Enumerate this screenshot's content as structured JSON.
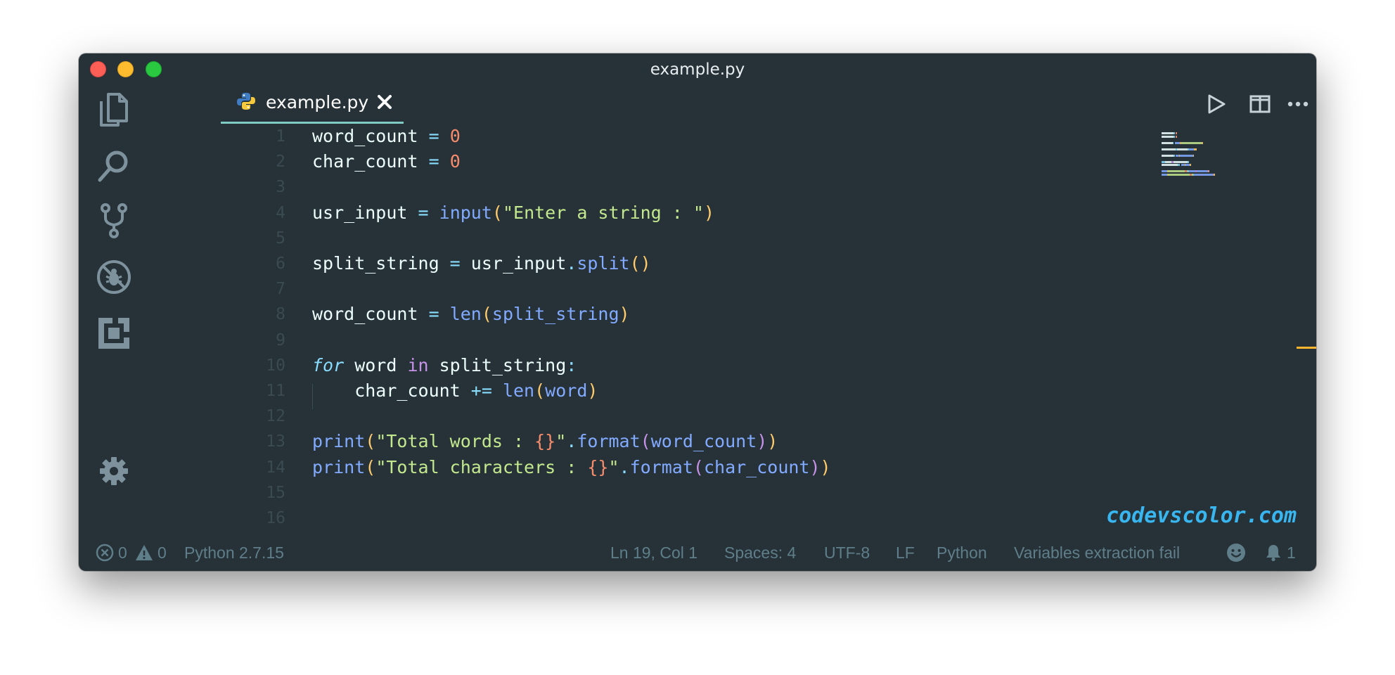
{
  "window": {
    "title": "example.py"
  },
  "activity_bar": {
    "items": [
      "explorer-icon",
      "search-icon",
      "source-control-icon",
      "debug-icon",
      "extensions-icon"
    ],
    "bottom": "gear-icon"
  },
  "tab": {
    "label": "example.py",
    "icon": "python-icon"
  },
  "editor_actions": [
    "run-icon",
    "split-editor-icon",
    "more-icon"
  ],
  "colors": {
    "background": "#263238",
    "variable": "#eeffff",
    "operator": "#89ddff",
    "number": "#f78c6c",
    "string": "#c3e88d",
    "function": "#82aaff",
    "keyword": "#c792ea",
    "paren": "#ffcb6b",
    "brace": "#f78c6c",
    "accent": "#80cbc4",
    "watermark": "#39b6f0"
  },
  "editor": {
    "line_numbers": [
      "1",
      "2",
      "3",
      "4",
      "5",
      "6",
      "7",
      "8",
      "9",
      "10",
      "11",
      "12",
      "13",
      "14",
      "15",
      "16"
    ],
    "lines": [
      [
        [
          "word_count ",
          "var"
        ],
        [
          "=",
          "op"
        ],
        [
          " ",
          "var"
        ],
        [
          "0",
          "num"
        ]
      ],
      [
        [
          "char_count ",
          "var"
        ],
        [
          "=",
          "op"
        ],
        [
          " ",
          "var"
        ],
        [
          "0",
          "num"
        ]
      ],
      [],
      [
        [
          "usr_input ",
          "var"
        ],
        [
          "=",
          "op"
        ],
        [
          " ",
          "var"
        ],
        [
          "input",
          "fn"
        ],
        [
          "(",
          "paren"
        ],
        [
          "\"Enter a string : \"",
          "str"
        ],
        [
          ")",
          "paren"
        ]
      ],
      [],
      [
        [
          "split_string ",
          "var"
        ],
        [
          "=",
          "op"
        ],
        [
          " usr_input",
          "var"
        ],
        [
          ".",
          "op"
        ],
        [
          "split",
          "fn"
        ],
        [
          "()",
          "paren"
        ]
      ],
      [],
      [
        [
          "word_count ",
          "var"
        ],
        [
          "=",
          "op"
        ],
        [
          " ",
          "var"
        ],
        [
          "len",
          "fn"
        ],
        [
          "(",
          "paren"
        ],
        [
          "split_string",
          "fn"
        ],
        [
          ")",
          "paren"
        ]
      ],
      [],
      [
        [
          "for",
          "kw-italic"
        ],
        [
          " word ",
          "var"
        ],
        [
          "in",
          "kw"
        ],
        [
          " split_string",
          "var"
        ],
        [
          ":",
          "op"
        ]
      ],
      [
        [
          "    char_count ",
          "var"
        ],
        [
          "+=",
          "op"
        ],
        [
          " ",
          "var"
        ],
        [
          "len",
          "fn"
        ],
        [
          "(",
          "paren"
        ],
        [
          "word",
          "fn"
        ],
        [
          ")",
          "paren"
        ]
      ],
      [],
      [
        [
          "print",
          "fn"
        ],
        [
          "(",
          "paren"
        ],
        [
          "\"Total words : ",
          "str"
        ],
        [
          "{}",
          "brace"
        ],
        [
          "\"",
          "str"
        ],
        [
          ".",
          "op"
        ],
        [
          "format",
          "fn"
        ],
        [
          "(",
          "paren2"
        ],
        [
          "word_count",
          "fn"
        ],
        [
          ")",
          "paren2"
        ],
        [
          ")",
          "paren"
        ]
      ],
      [
        [
          "print",
          "fn"
        ],
        [
          "(",
          "paren"
        ],
        [
          "\"Total characters : ",
          "str"
        ],
        [
          "{}",
          "brace"
        ],
        [
          "\"",
          "str"
        ],
        [
          ".",
          "op"
        ],
        [
          "format",
          "fn"
        ],
        [
          "(",
          "paren2"
        ],
        [
          "char_count",
          "fn"
        ],
        [
          ")",
          "paren2"
        ],
        [
          ")",
          "paren"
        ]
      ],
      [],
      []
    ]
  },
  "watermark": "codevscolor.com",
  "status_bar": {
    "errors": "0",
    "warnings": "0",
    "interpreter": "Python 2.7.15",
    "cursor": "Ln 19, Col 1",
    "spaces": "Spaces: 4",
    "encoding": "UTF-8",
    "eol": "LF",
    "language": "Python",
    "message": "Variables extraction fail",
    "notifications": "1"
  }
}
